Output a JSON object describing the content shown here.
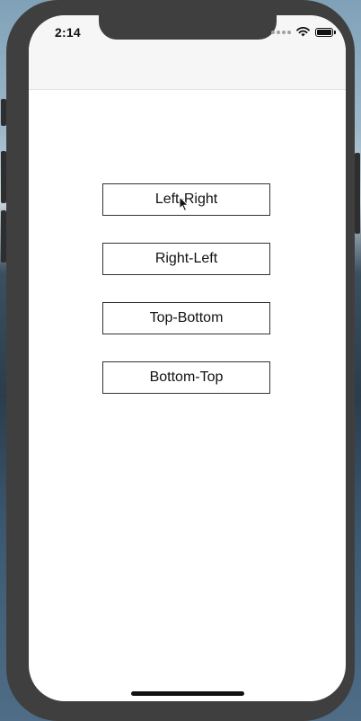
{
  "status_bar": {
    "time": "2:14",
    "icons": [
      "signal-dots-icon",
      "wifi-icon",
      "battery-icon"
    ]
  },
  "buttons": [
    {
      "label": "Left-Right"
    },
    {
      "label": "Right-Left"
    },
    {
      "label": "Top-Bottom"
    },
    {
      "label": "Bottom-Top"
    }
  ],
  "colors": {
    "device_frame": "#3f3f3f",
    "navbar_background": "#f6f6f6",
    "screen_background": "#ffffff",
    "button_border": "#333333"
  }
}
